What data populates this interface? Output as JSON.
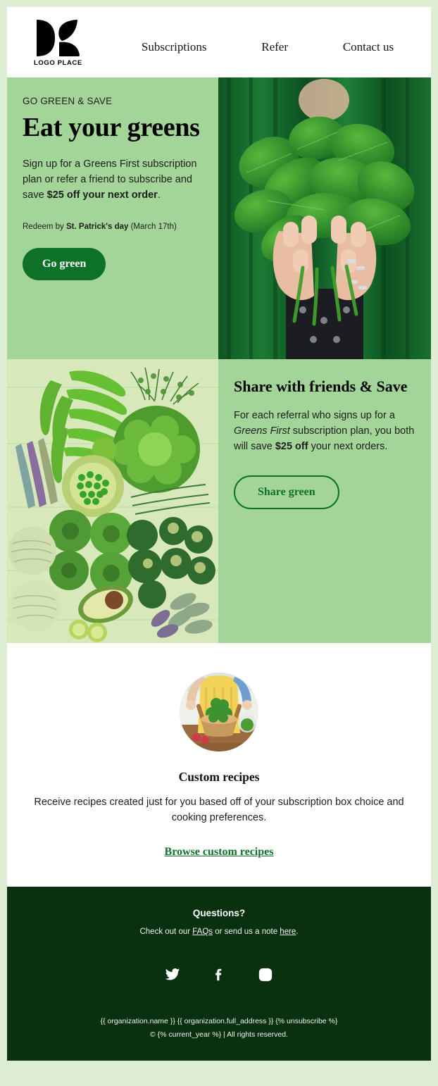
{
  "colors": {
    "page_bg": "#ddeed4",
    "section_green": "#a3d598",
    "brand_green": "#0d7227",
    "footer_green": "#09300f",
    "white": "#ffffff"
  },
  "header": {
    "logo_text": "LOGO PLACE",
    "logo_icon": "leaf-logo-icon",
    "nav": [
      {
        "label": "Subscriptions"
      },
      {
        "label": "Refer"
      },
      {
        "label": "Contact us"
      }
    ]
  },
  "hero": {
    "eyebrow": "GO GREEN & SAVE",
    "title": "Eat your greens",
    "body_1": "Sign up for a Greens First subscription plan or refer a friend to subscribe and save ",
    "body_bold": "$25 off your next order",
    "body_2": ".",
    "redeem_1": "Redeem by ",
    "redeem_bold": "St. Patrick's day",
    "redeem_2": " (March 17th)",
    "cta": "Go green",
    "image_alt": "person-holding-spinach-bunch"
  },
  "share": {
    "title": "Share with friends & Save",
    "body_1": "For each referral who signs up for a ",
    "body_italic": "Greens First",
    "body_2": " subscription plan, you both will save ",
    "body_bold": "$25 off",
    "body_3": " your next orders.",
    "cta": "Share green",
    "image_alt": "green-vegetables-flat-lay"
  },
  "recipes": {
    "title": "Custom recipes",
    "body": "Receive recipes created just for you based off of your subscription box choice and cooking preferences.",
    "link": "Browse custom recipes",
    "image_alt": "person-tossing-salad-in-bowl"
  },
  "footer": {
    "questions": "Questions?",
    "check_1": "Check out our ",
    "faqs_link": "FAQs",
    "check_2": " or send us a note ",
    "here_link": "here",
    "check_3": ".",
    "socials": [
      {
        "name": "twitter-icon"
      },
      {
        "name": "facebook-icon"
      },
      {
        "name": "instagram-icon"
      }
    ],
    "legal_line1": "{{ organization.name }} {{ organization.full_address }} {% unsubscribe %}",
    "legal_line2": "© {% current_year %} | All rights reserved."
  }
}
